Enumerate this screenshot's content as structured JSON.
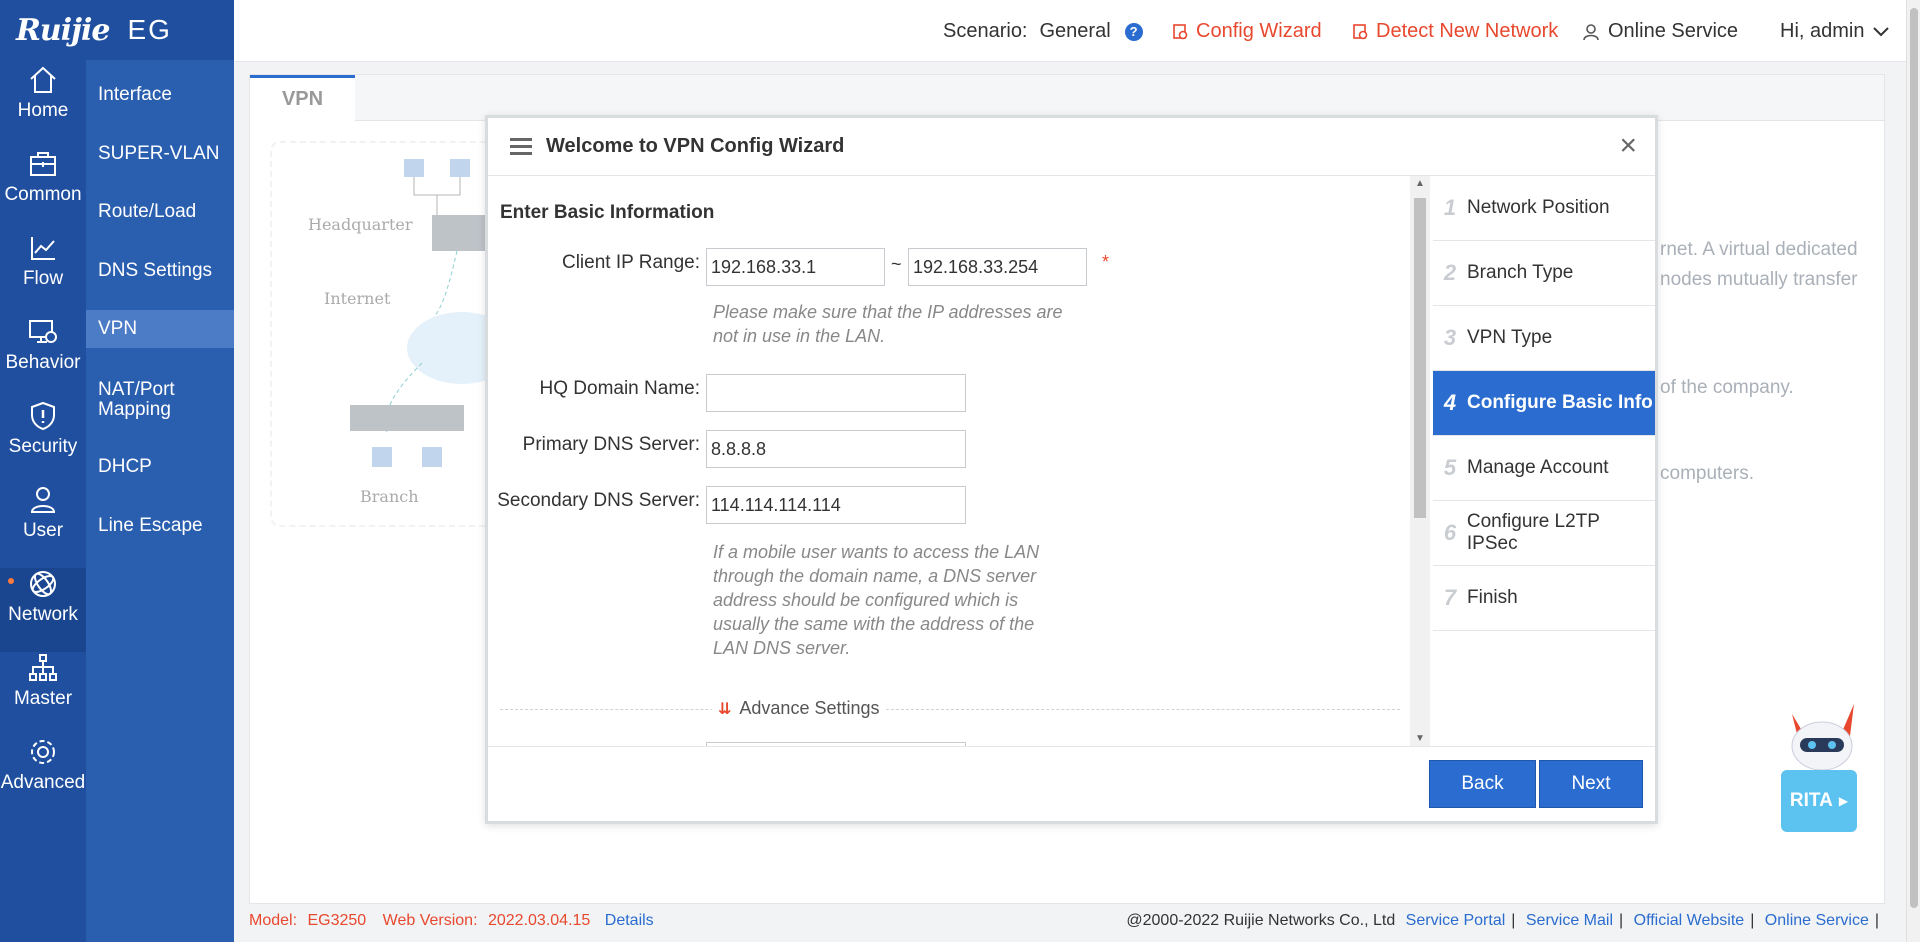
{
  "logo": {
    "brand": "Ruijie",
    "product": "EG"
  },
  "rail": [
    {
      "label": "Home",
      "icon": "home-icon"
    },
    {
      "label": "Common",
      "icon": "toolbox-icon"
    },
    {
      "label": "Flow",
      "icon": "line-chart-icon"
    },
    {
      "label": "Behavior",
      "icon": "monitor-gear-icon"
    },
    {
      "label": "Security",
      "icon": "shield-icon"
    },
    {
      "label": "User",
      "icon": "user-icon"
    },
    {
      "label": "Network",
      "icon": "globe-icon",
      "active": true
    },
    {
      "label": "Master",
      "icon": "hierarchy-icon"
    },
    {
      "label": "Advanced",
      "icon": "gear-icon"
    }
  ],
  "subnav": [
    {
      "label": "Interface"
    },
    {
      "label": "SUPER-VLAN"
    },
    {
      "label": "Route/Load"
    },
    {
      "label": "DNS Settings"
    },
    {
      "label": "VPN",
      "active": true
    },
    {
      "label": "NAT/Port Mapping"
    },
    {
      "label": "DHCP"
    },
    {
      "label": "Line Escape"
    }
  ],
  "topbar": {
    "scenario_label": "Scenario:",
    "scenario_value": "General",
    "help": "?",
    "config_wizard": "Config Wizard",
    "detect_network": "Detect New Network",
    "online_service": "Online Service",
    "greeting": "Hi, admin"
  },
  "content": {
    "tab": "VPN",
    "diagram": {
      "headquarter": "Headquarter",
      "internet": "Internet",
      "branch": "Branch"
    },
    "bg_text": [
      "rnet. A virtual dedicated",
      "nodes mutually transfer",
      "of the company.",
      "computers."
    ]
  },
  "modal": {
    "title": "Welcome to VPN Config Wizard",
    "close": "×",
    "section_title": "Enter Basic Information",
    "fields": {
      "client_ip_label": "Client IP Range:",
      "client_ip_start": "192.168.33.1",
      "client_ip_sep": "~",
      "client_ip_end": "192.168.33.254",
      "required_mark": "*",
      "client_ip_hint_1": "Please make sure that the IP addresses are",
      "client_ip_hint_2": "not in use in the LAN.",
      "hq_domain_label": "HQ Domain Name:",
      "hq_domain_value": "",
      "primary_dns_label": "Primary DNS Server:",
      "primary_dns_value": "8.8.8.8",
      "secondary_dns_label": "Secondary DNS Server:",
      "secondary_dns_value": "114.114.114.114",
      "dns_hint": [
        "If a mobile user wants to access the LAN",
        "through the domain name, a DNS server",
        "address should be configured which is",
        "usually the same with the address of the",
        "LAN DNS server."
      ]
    },
    "advance_settings": "Advance Settings",
    "steps": [
      {
        "num": "1",
        "label": "Network Position"
      },
      {
        "num": "2",
        "label": "Branch Type"
      },
      {
        "num": "3",
        "label": "VPN Type"
      },
      {
        "num": "4",
        "label": "Configure Basic Info",
        "active": true
      },
      {
        "num": "5",
        "label": "Manage Account"
      },
      {
        "num": "6",
        "label": "Configure L2TP IPSec"
      },
      {
        "num": "7",
        "label": "Finish"
      }
    ],
    "back": "Back",
    "next": "Next"
  },
  "assistant": {
    "label": "RITA"
  },
  "footer": {
    "model_label": "Model:",
    "model": "EG3250",
    "web_version_label": "Web Version:",
    "web_version": "2022.03.04.15",
    "details": "Details",
    "copyright": "@2000-2022 Ruijie Networks Co., Ltd",
    "links": [
      "Service Portal",
      "Service Mail",
      "Official Website",
      "Online Service"
    ]
  },
  "colors": {
    "sidebar": "#1f4f9e",
    "subnav": "#2a5fb0",
    "accent": "#2a6ccf",
    "alert": "#e8482e"
  }
}
